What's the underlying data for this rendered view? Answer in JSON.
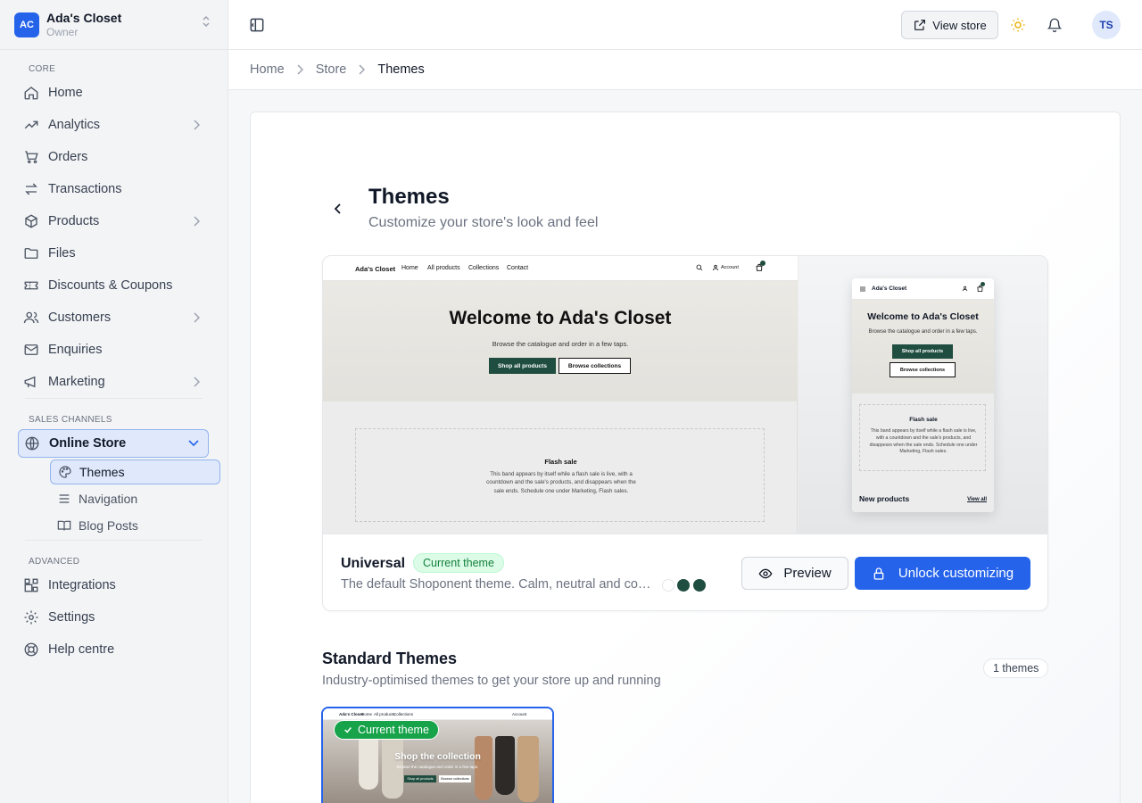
{
  "store": {
    "logo": "AC",
    "name": "Ada's Closet",
    "role": "Owner"
  },
  "sidebar": {
    "sections": {
      "core": "CORE",
      "sales": "SALES CHANNELS",
      "advanced": "ADVANCED"
    },
    "items": [
      {
        "label": "Home",
        "icon": "home-icon"
      },
      {
        "label": "Analytics",
        "icon": "trend-icon"
      },
      {
        "label": "Orders",
        "icon": "cart-icon"
      },
      {
        "label": "Transactions",
        "icon": "transfer-icon"
      },
      {
        "label": "Products",
        "icon": "box-icon"
      },
      {
        "label": "Files",
        "icon": "folder-icon"
      },
      {
        "label": "Discounts & Coupons",
        "icon": "ticket-icon"
      },
      {
        "label": "Customers",
        "icon": "users-icon"
      },
      {
        "label": "Enquiries",
        "icon": "mail-icon"
      },
      {
        "label": "Marketing",
        "icon": "megaphone-icon"
      }
    ],
    "online_store": "Online Store",
    "sub_items": [
      {
        "label": "Themes",
        "icon": "palette-icon"
      },
      {
        "label": "Navigation",
        "icon": "menu-icon"
      },
      {
        "label": "Blog Posts",
        "icon": "book-icon"
      }
    ],
    "advanced_items": [
      {
        "label": "Integrations",
        "icon": "integrations-icon"
      },
      {
        "label": "Settings",
        "icon": "gear-icon"
      },
      {
        "label": "Help centre",
        "icon": "lifebuoy-icon"
      }
    ]
  },
  "topbar": {
    "view_store": "View store",
    "avatar": "TS"
  },
  "breadcrumb": [
    "Home",
    "Store",
    "Themes"
  ],
  "page": {
    "title": "Themes",
    "subtitle": "Customize your store's look and feel"
  },
  "preview": {
    "desktop": {
      "brand": "Ada's Closet",
      "nav": [
        "Home",
        "All products",
        "Collections",
        "Contact"
      ],
      "account": "Account",
      "hero_title": "Welcome to Ada's Closet",
      "hero_text": "Browse the catalogue and order in a few taps.",
      "btn_primary": "Shop all products",
      "btn_secondary": "Browse collections",
      "flash_title": "Flash sale",
      "flash_text": "This band appears by itself while a flash sale is live, with a countdown and the sale's products, and disappears when the sale ends. Schedule one under Marketing, Flash sales."
    },
    "mobile": {
      "brand": "Ada's Closet",
      "hero_title": "Welcome to Ada's Closet",
      "hero_text": "Browse the catalogue and order in a few taps.",
      "btn_primary": "Shop all products",
      "btn_secondary": "Browse collections",
      "flash_title": "Flash sale",
      "flash_text": "This band appears by itself while a flash sale is live, with a countdown and the sale's products, and disappears when the sale ends. Schedule one under Marketing, Flash sales.",
      "new_products": "New products",
      "view_all": "View all"
    }
  },
  "theme": {
    "name": "Universal",
    "badge": "Current theme",
    "description": "The default Shoponent theme. Calm, neutral and considered.",
    "swatches": [
      "#ffffff",
      "#1f4d3f",
      "#1f4d3f"
    ],
    "preview_btn": "Preview",
    "unlock_btn": "Unlock customizing"
  },
  "standard": {
    "title": "Standard Themes",
    "subtitle": "Industry-optimised themes to get your store up and running",
    "count": "1 themes",
    "thumb": {
      "badge": "Current theme",
      "brand": "Ada's Closet",
      "nav": [
        "Home",
        "All products",
        "Collections"
      ],
      "account": "Account",
      "hero_title": "Shop the collection",
      "hero_text": "Browse the catalogue and order in a few taps.",
      "btn_primary": "Shop all products",
      "btn_secondary": "Browse collections"
    }
  },
  "colors": {
    "accent": "#2563eb",
    "brand_green": "#1f4d3f",
    "success": "#16a34a"
  }
}
